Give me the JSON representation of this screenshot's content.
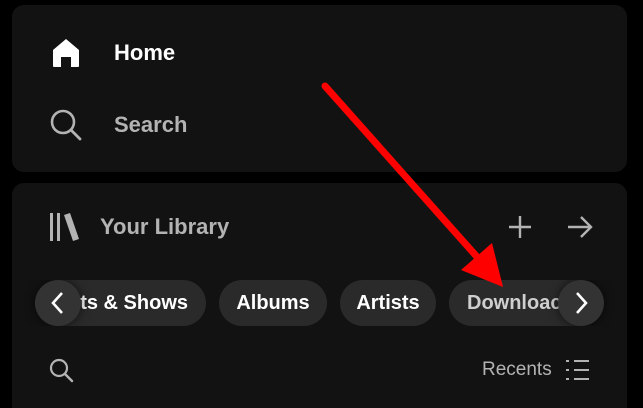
{
  "nav": {
    "home_label": "Home",
    "home_icon": "home-icon",
    "search_label": "Search",
    "search_icon": "search-icon"
  },
  "library": {
    "title": "Your Library",
    "icon": "library-icon",
    "create_icon": "plus-icon",
    "expand_icon": "arrow-right-icon",
    "chips": [
      {
        "label": "ts & Shows"
      },
      {
        "label": "Albums"
      },
      {
        "label": "Artists"
      },
      {
        "label": "Downloac"
      }
    ],
    "scroll_left_icon": "chevron-left-icon",
    "scroll_right_icon": "chevron-right-icon",
    "search_icon": "search-icon",
    "sort_label": "Recents",
    "sort_icon": "list-icon"
  },
  "annotation": {
    "type": "red-arrow",
    "color": "#ff0000"
  },
  "colors": {
    "background": "#000000",
    "panel": "#121212",
    "chip": "#2a2a2a",
    "text_primary": "#ffffff",
    "text_secondary": "#b3b3b3"
  }
}
